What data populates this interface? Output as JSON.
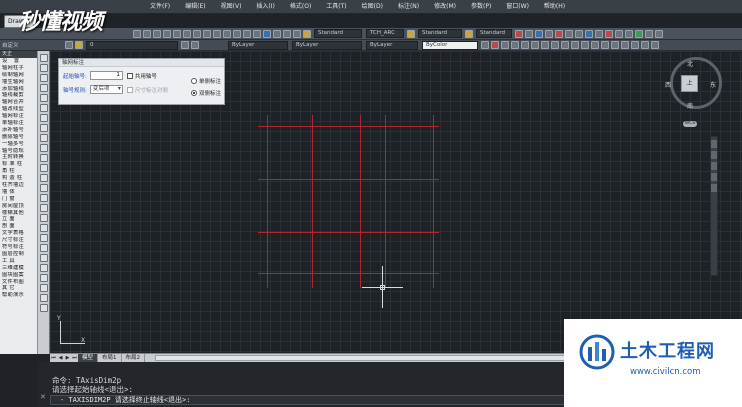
{
  "app": {
    "draw_tab": "Draw",
    "watermark_logo": "秒懂视频"
  },
  "menu": [
    "文件(F)",
    "编辑(E)",
    "视图(V)",
    "插入(I)",
    "格式(O)",
    "工具(T)",
    "绘图(D)",
    "标注(N)",
    "修改(M)",
    "参数(P)",
    "窗口(W)",
    "帮助(H)"
  ],
  "toolbar": {
    "workspace": "自定义",
    "textstyle_1": "Standard",
    "textstyle_2": "TCH_ARC",
    "dimstyle": "Standard",
    "tablestyle": "Standard",
    "layer": "0",
    "color": "ByLayer",
    "linetype": "ByLayer",
    "lineweight": "ByLayer",
    "plotstyle": "ByColor"
  },
  "sidebar": {
    "header": "天正",
    "items": [
      "设 置",
      "轴网柱子",
      "绘制轴网",
      "墙生轴网",
      "添加轴线",
      "轴线裁剪",
      "轴网合并",
      "轴改线型",
      "轴网标注",
      "单轴标注",
      "添补轴号",
      "删除轴号",
      "一轴多号",
      "轴号隐现",
      "主附转换",
      "标 准 柱",
      "角 柱",
      "构 造 柱",
      "柱齐墙边",
      "墙 体",
      "门 窗",
      "房间屋顶",
      "楼梯其他",
      "立 面",
      "剖 面",
      "文字表格",
      "尺寸标注",
      "符号标注",
      "图层控制",
      "工 具",
      "三维建模",
      "图块图案",
      "文件布图",
      "其 它",
      "帮助演示"
    ]
  },
  "dialog": {
    "title": "轴网标注",
    "start_label": "起始轴号:",
    "start_value": "1",
    "shared_label": "共用轴号",
    "rule_label": "轴号规则:",
    "rule_value": "变后项",
    "dim_scale_label": "尺寸标注对侧",
    "single_side": "单侧标注",
    "double_side": "双侧标注"
  },
  "viewcube": {
    "north": "北",
    "south": "南",
    "west": "西",
    "east": "东",
    "top": "上",
    "wcs": "WCS"
  },
  "ucs": {
    "x": "X",
    "y": "Y"
  },
  "layout_tabs": [
    "模型",
    "布局1",
    "布局2"
  ],
  "command": {
    "line1": "命令: TAxisDim2p",
    "line2": "请选择起始轴线<退出>:",
    "input": "- TAXISDIM2P 请选择终止轴线<退出>:"
  },
  "watermark": {
    "title": "土木工程网",
    "url": "www.civilcn.com"
  },
  "colors": {
    "axis_line": "#b3262b",
    "canvas": "#1e2126",
    "watermark_blue": "#1f5fb3"
  }
}
